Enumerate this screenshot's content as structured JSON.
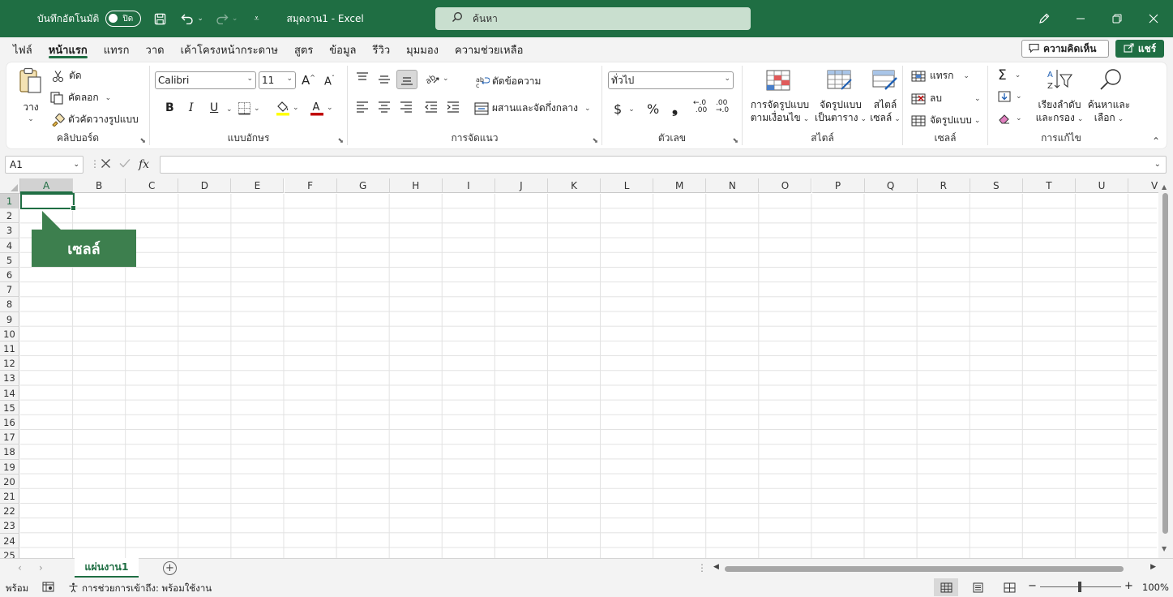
{
  "titlebar": {
    "autosave_label": "บันทึกอัตโนมัติ",
    "autosave_state": "ปิด",
    "doc_title": "สมุดงาน1 - Excel",
    "search_placeholder": "ค้นหา",
    "icons": [
      "save-icon",
      "undo-icon",
      "redo-icon",
      "customize-qat-icon",
      "pen-icon",
      "minimize-icon",
      "restore-icon",
      "close-icon"
    ]
  },
  "menu": {
    "tabs": [
      "ไฟล์",
      "หน้าแรก",
      "แทรก",
      "วาด",
      "เค้าโครงหน้ากระดาษ",
      "สูตร",
      "ข้อมูล",
      "รีวิว",
      "มุมมอง",
      "ความช่วยเหลือ"
    ],
    "active_tab": "หน้าแรก",
    "comments_label": "ความคิดเห็น",
    "share_label": "แชร์"
  },
  "ribbon": {
    "clipboard": {
      "paste": "วาง",
      "cut": "ตัด",
      "copy": "คัดลอก",
      "format_painter": "ตัวคัดวางรูปแบบ",
      "label": "คลิปบอร์ด"
    },
    "font": {
      "family": "Calibri",
      "size": "11",
      "bold": "B",
      "italic": "I",
      "underline": "U",
      "font_color": "#c00000",
      "highlight_color": "#ffff00",
      "label": "แบบอักษร"
    },
    "alignment": {
      "wrap_text": "ตัดข้อความ",
      "merge_center": "ผสานและจัดกึ่งกลาง",
      "label": "การจัดแนว"
    },
    "number": {
      "format": "ทั่วไป",
      "currency": "$",
      "percent": "%",
      "comma": "❜",
      "inc_decimal": "←.0 .00",
      "dec_decimal": ".00 →.0",
      "label": "ตัวเลข"
    },
    "styles": {
      "conditional_l1": "การจัดรูปแบบ",
      "conditional_l2": "ตามเงื่อนไข",
      "table_l1": "จัดรูปแบบ",
      "table_l2": "เป็นตาราง",
      "cell_l1": "สไตล์",
      "cell_l2": "เซลล์",
      "label": "สไตล์"
    },
    "cells": {
      "insert": "แทรก",
      "delete": "ลบ",
      "format": "จัดรูปแบบ",
      "label": "เซลล์"
    },
    "editing": {
      "sort_l1": "เรียงลำดับ",
      "sort_l2": "และกรอง",
      "find_l1": "ค้นหาและ",
      "find_l2": "เลือก",
      "label": "การแก้ไข"
    }
  },
  "formula_bar": {
    "name_box": "A1",
    "fx": "fx",
    "value": ""
  },
  "grid": {
    "columns": [
      "A",
      "B",
      "C",
      "D",
      "E",
      "F",
      "G",
      "H",
      "I",
      "J",
      "K",
      "L",
      "M",
      "N",
      "O",
      "P",
      "Q",
      "R",
      "S",
      "T",
      "U",
      "V"
    ],
    "rows": [
      "1",
      "2",
      "3",
      "4",
      "5",
      "6",
      "7",
      "8",
      "9",
      "10",
      "11",
      "12",
      "13",
      "14",
      "15",
      "16",
      "17",
      "18",
      "19",
      "20",
      "21",
      "22",
      "23",
      "24",
      "25"
    ],
    "selected_column": "A",
    "selected_row": "1",
    "callout": "เซลล์"
  },
  "sheets": {
    "tabs": [
      "แผ่นงาน1"
    ],
    "active": "แผ่นงาน1"
  },
  "status": {
    "ready": "พร้อม",
    "accessibility": "การช่วยการเข้าถึง: พร้อมใช้งาน",
    "zoom": "100%",
    "zoom_minus": "−",
    "zoom_plus": "+"
  },
  "colors": {
    "brand": "#1f6e43",
    "callout": "#3d7f4e",
    "search_bg": "#c9dfcf"
  }
}
